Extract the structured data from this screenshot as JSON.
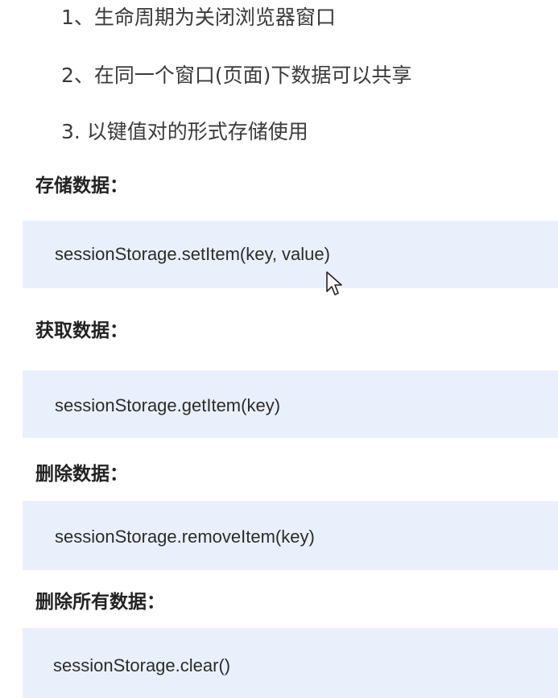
{
  "features": [
    "1、生命周期为关闭浏览器窗口",
    "2、在同一个窗口(页面)下数据可以共享",
    "3. 以键值对的形式存储使用"
  ],
  "sections": [
    {
      "heading": "存储数据：",
      "code": "sessionStorage.setItem(key, value)"
    },
    {
      "heading": "获取数据：",
      "code": "sessionStorage.getItem(key)"
    },
    {
      "heading": "删除数据：",
      "code": "sessionStorage.removeItem(key)"
    },
    {
      "heading": "删除所有数据：",
      "code": "sessionStorage.clear()"
    }
  ],
  "icons": {
    "cursor": "mouse-pointer-icon"
  },
  "colors": {
    "code_background": "#eaf0fb",
    "text": "#333333"
  }
}
